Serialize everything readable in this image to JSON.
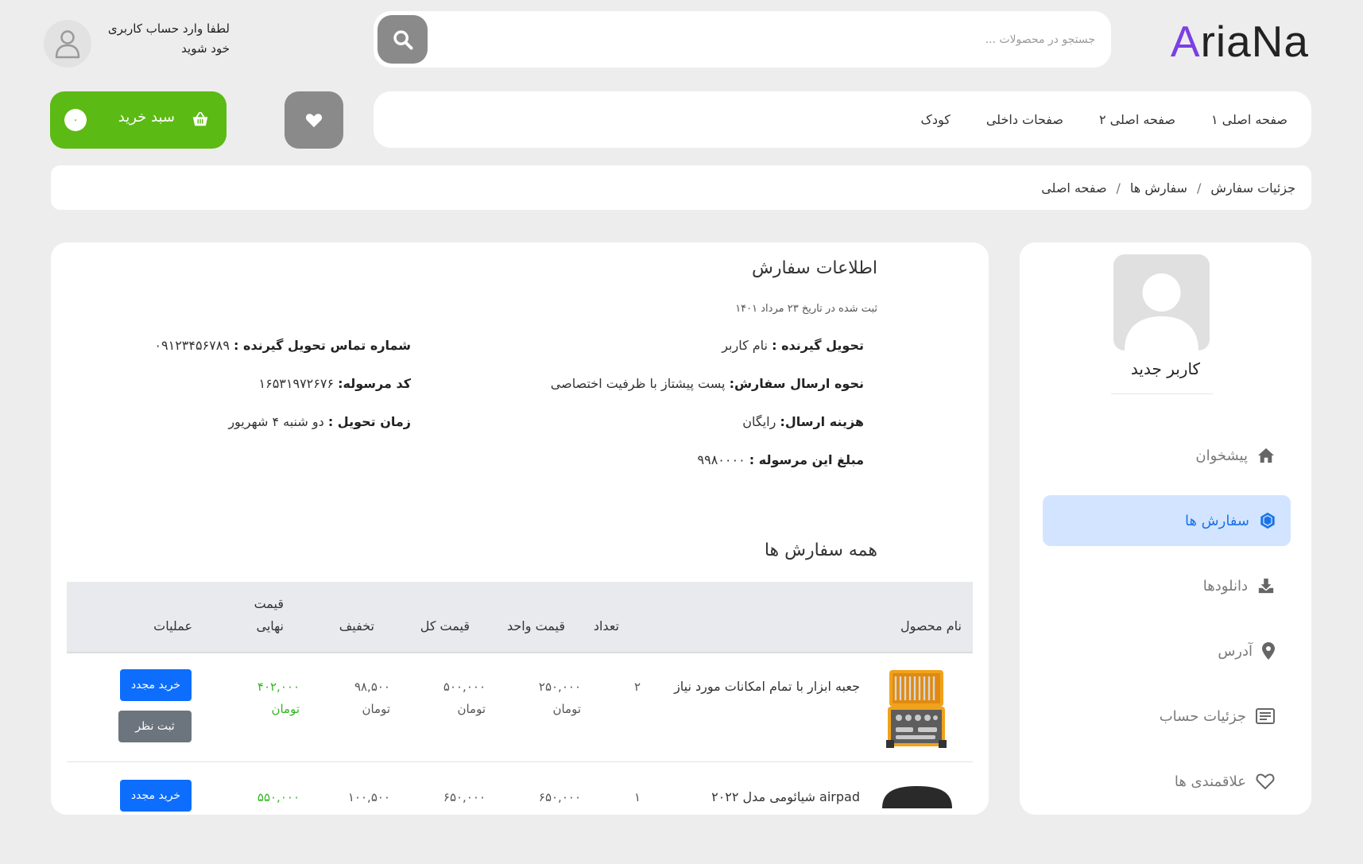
{
  "header": {
    "logo_part1": "A",
    "logo_part2": "riaNa",
    "search_placeholder": "جستجو در محصولات ...",
    "login_line1": "لطفا وارد حساب کاربری",
    "login_line2": "خود شوید"
  },
  "nav": {
    "items": [
      "صفحه اصلی ۱",
      "صفحه اصلی ۲",
      "صفحات داخلی",
      "کودک"
    ]
  },
  "cart": {
    "label": "سبد خرید",
    "count": "۰"
  },
  "breadcrumb": {
    "items": [
      "صفحه اصلی",
      "سفارش ها",
      "جزئیات سفارش"
    ],
    "separator": "/"
  },
  "sidebar": {
    "user_name": "کاربر جدید",
    "menu": [
      {
        "label": "پیشخوان",
        "icon": "home-icon"
      },
      {
        "label": "سفارش ها",
        "icon": "box-icon"
      },
      {
        "label": "دانلودها",
        "icon": "download-icon"
      },
      {
        "label": "آدرس",
        "icon": "map-pin-icon"
      },
      {
        "label": "جزئیات حساب",
        "icon": "id-card-icon"
      },
      {
        "label": "علاقمندی ها",
        "icon": "heart-icon"
      }
    ]
  },
  "order_info": {
    "title": "اطلاعات سفارش",
    "date": "ثبت شده در تاریخ ۲۳ مرداد ۱۴۰۱",
    "recipient_label": "تحویل گیرنده :",
    "recipient_value": "نام کاربر",
    "shipping_method_label": "نحوه ارسال سفارش:",
    "shipping_method_value": "پست پیشتاز با ظرفیت اختصاصی",
    "shipping_cost_label": "هزینه ارسال:",
    "shipping_cost_value": "رایگان",
    "amount_label": "مبلغ این مرسوله :",
    "amount_value": "۹۹۸۰۰۰۰",
    "phone_label": "شماره تماس تحویل گیرنده :",
    "phone_value": "۰۹۱۲۳۴۵۶۷۸۹",
    "tracking_label": "کد مرسوله:",
    "tracking_value": "۱۶۵۳۱۹۷۲۶۷۶",
    "delivery_time_label": "زمان تحویل :",
    "delivery_time_value": "دو شنبه ۴ شهریور"
  },
  "orders": {
    "title": "همه سفارش ها",
    "columns": {
      "name": "نام محصول",
      "qty": "تعداد",
      "unit_price": "قیمت واحد",
      "total_price": "قیمت کل",
      "discount": "تخفیف",
      "final_price_line1": "قیمت",
      "final_price_line2": "نهایی",
      "actions": "عملیات"
    },
    "currency": "تومان",
    "rows": [
      {
        "name": "جعبه ابزار با تمام امکانات مورد نیاز",
        "qty": "۲",
        "unit_price": "۲۵۰,۰۰۰",
        "total_price": "۵۰۰,۰۰۰",
        "discount": "۹۸,۵۰۰",
        "final_price": "۴۰۲,۰۰۰",
        "rebuy": "خرید مجدد",
        "review": "ثبت نظر"
      },
      {
        "name": "airpad شیائومی مدل ۲۰۲۲",
        "qty": "۱",
        "unit_price": "۶۵۰,۰۰۰",
        "total_price": "۶۵۰,۰۰۰",
        "discount": "۱۰۰,۵۰۰",
        "final_price": "۵۵۰,۰۰۰",
        "rebuy": "خرید مجدد"
      }
    ]
  },
  "colors": {
    "accent_green": "#5bba14",
    "active_blue": "#1a73e8",
    "logo_purple": "#7b3fe4",
    "price_green": "#33b521"
  }
}
